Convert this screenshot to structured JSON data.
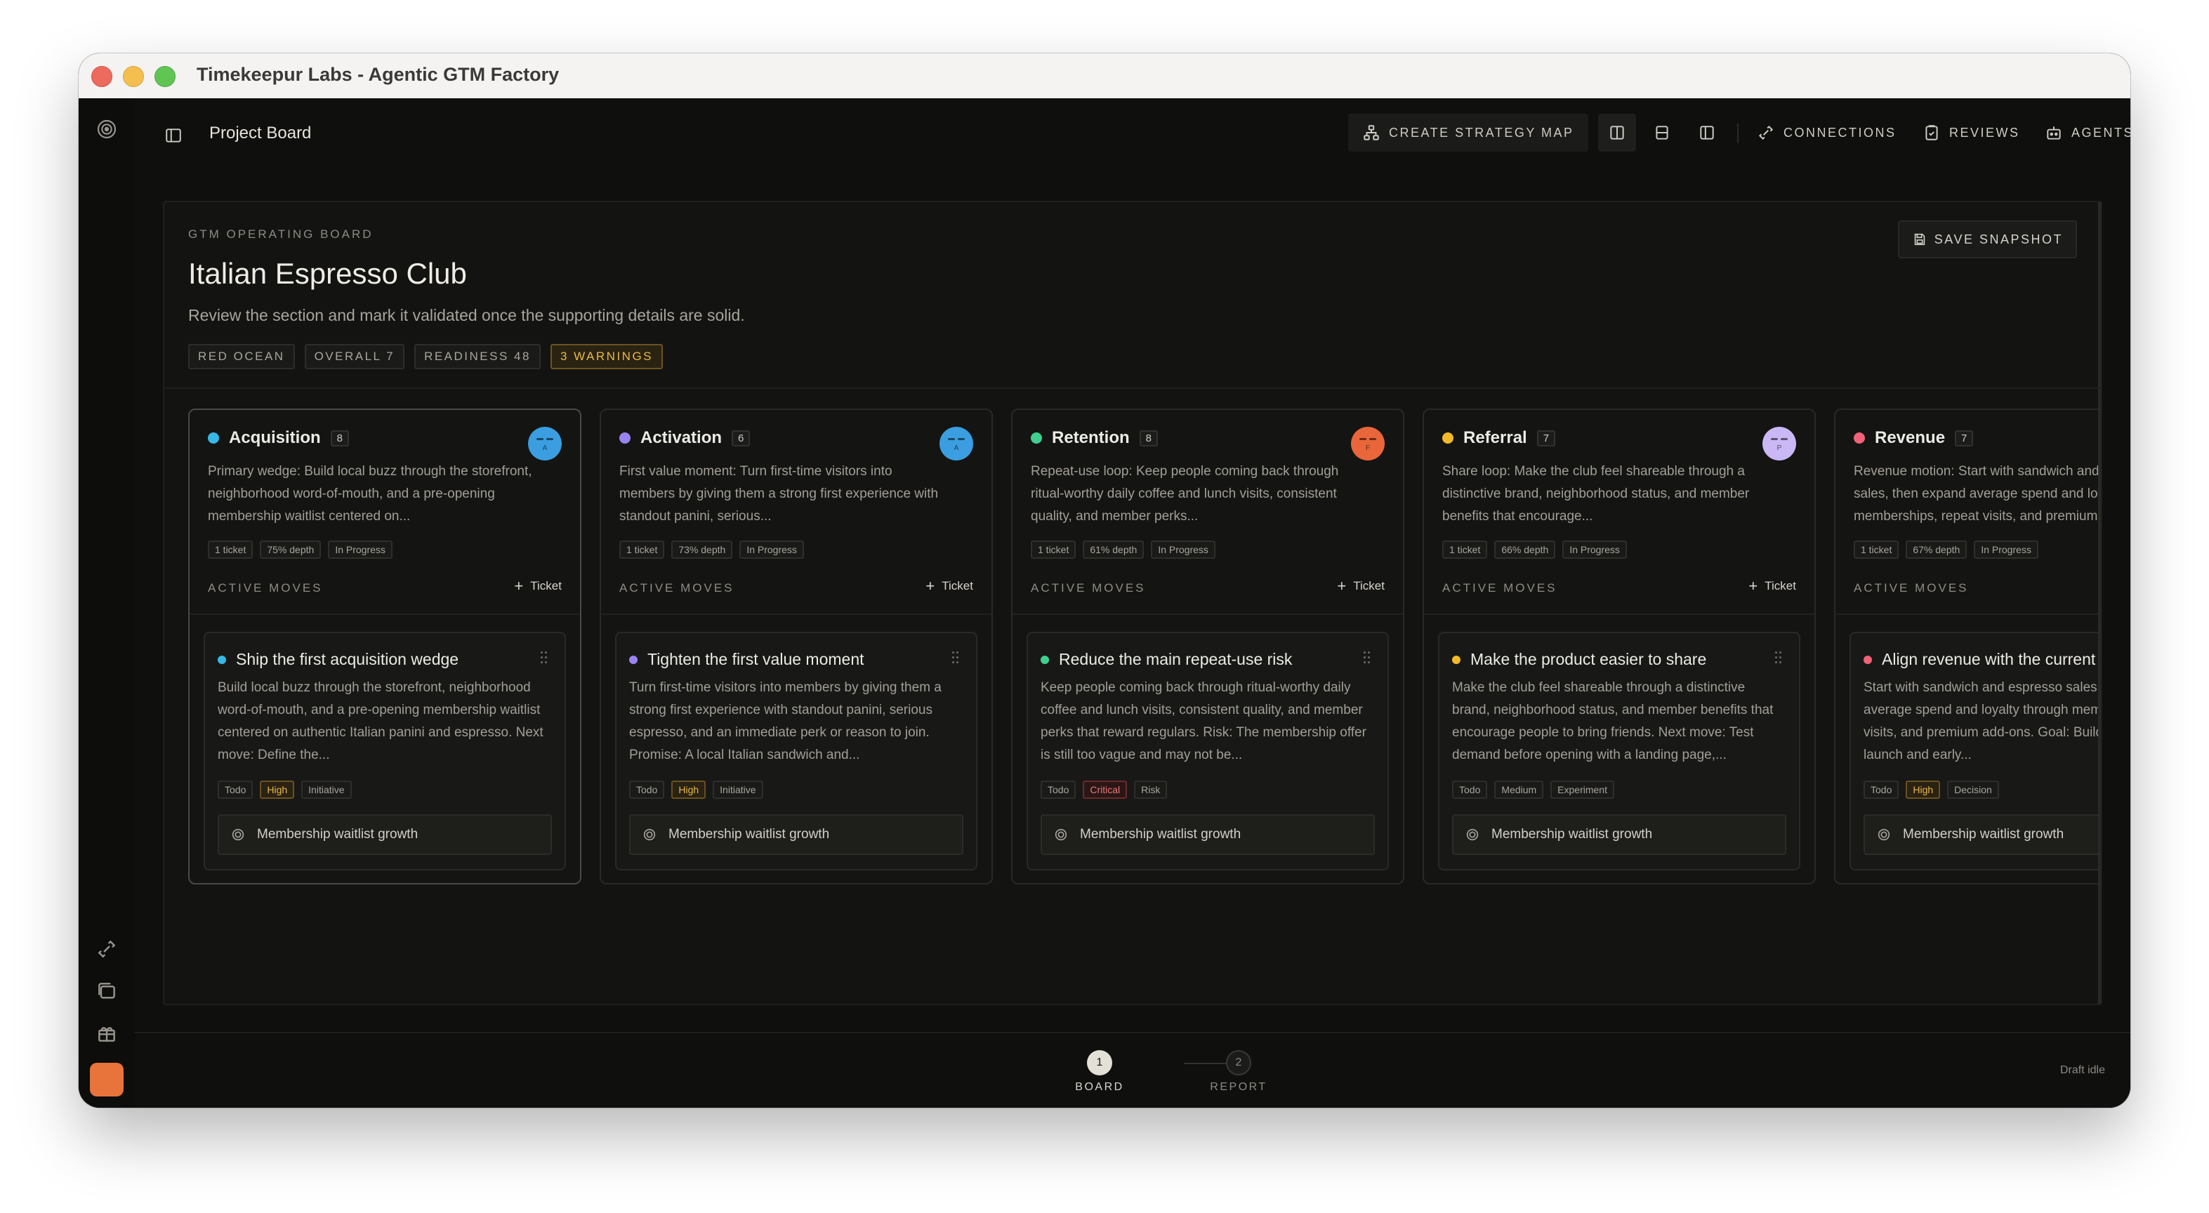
{
  "window": {
    "title": "Timekeepur Labs - Agentic GTM Factory"
  },
  "topbar": {
    "page_title": "Project Board",
    "create_strategy_map": "CREATE STRATEGY MAP",
    "connections": "CONNECTIONS",
    "reviews": "REVIEWS",
    "agents": "AGENTS"
  },
  "board": {
    "eyebrow": "GTM OPERATING BOARD",
    "title": "Italian Espresso Club",
    "description": "Review the section and mark it validated once the supporting details are solid.",
    "chips": [
      "RED OCEAN",
      "OVERALL 7",
      "READINESS 48",
      "3 WARNINGS"
    ],
    "save_snapshot": "SAVE SNAPSHOT",
    "active_moves_label": "ACTIVE MOVES",
    "ticket_label": "Ticket",
    "columns": [
      {
        "name": "Acquisition",
        "count": "8",
        "color": "#37b7e6",
        "avatar_color": "#3a9ee0",
        "avatar_letter": "A",
        "description": "Primary wedge: Build local buzz through the storefront, neighborhood word-of-mouth, and a pre-opening membership waitlist centered on...",
        "meta": [
          "1 ticket",
          "75% depth",
          "In Progress"
        ],
        "card": {
          "title": "Ship the first acquisition wedge",
          "description": "Build local buzz through the storefront, neighborhood word-of-mouth, and a pre-opening membership waitlist centered on authentic Italian panini and espresso. Next move: Define the...",
          "tags": [
            "Todo",
            "High",
            "Initiative"
          ],
          "metric": "Membership waitlist growth"
        }
      },
      {
        "name": "Activation",
        "count": "6",
        "color": "#9a83f0",
        "avatar_color": "#3a9ee0",
        "avatar_letter": "A",
        "description": "First value moment: Turn first-time visitors into members by giving them a strong first experience with standout panini, serious...",
        "meta": [
          "1 ticket",
          "73% depth",
          "In Progress"
        ],
        "card": {
          "title": "Tighten the first value moment",
          "description": "Turn first-time visitors into members by giving them a strong first experience with standout panini, serious espresso, and an immediate perk or reason to join. Promise: A local Italian sandwich and...",
          "tags": [
            "Todo",
            "High",
            "Initiative"
          ],
          "metric": "Membership waitlist growth"
        }
      },
      {
        "name": "Retention",
        "count": "8",
        "color": "#3ecf8e",
        "avatar_color": "#e8663a",
        "avatar_letter": "F",
        "description": "Repeat-use loop: Keep people coming back through ritual-worthy daily coffee and lunch visits, consistent quality, and member perks...",
        "meta": [
          "1 ticket",
          "61% depth",
          "In Progress"
        ],
        "card": {
          "title": "Reduce the main repeat-use risk",
          "description": "Keep people coming back through ritual-worthy daily coffee and lunch visits, consistent quality, and member perks that reward regulars. Risk: The membership offer is still too vague and may not be...",
          "tags": [
            "Todo",
            "Critical",
            "Risk"
          ],
          "metric": "Membership waitlist growth"
        }
      },
      {
        "name": "Referral",
        "count": "7",
        "color": "#f2b92b",
        "avatar_color": "#c9b8f5",
        "avatar_letter": "P",
        "description": "Share loop: Make the club feel shareable through a distinctive brand, neighborhood status, and member benefits that encourage...",
        "meta": [
          "1 ticket",
          "66% depth",
          "In Progress"
        ],
        "card": {
          "title": "Make the product easier to share",
          "description": "Make the club feel shareable through a distinctive brand, neighborhood status, and member benefits that encourage people to bring friends. Next move: Test demand before opening with a landing page,...",
          "tags": [
            "Todo",
            "Medium",
            "Experiment"
          ],
          "metric": "Membership waitlist growth"
        }
      },
      {
        "name": "Revenue",
        "count": "7",
        "color": "#f06277",
        "avatar_color": "",
        "avatar_letter": "",
        "description": "Revenue motion: Start with sandwich and espresso sales, then expand average spend and loyalty through memberships, repeat visits, and premium...",
        "meta": [
          "1 ticket",
          "67% depth",
          "In Progress"
        ],
        "card": {
          "title": "Align revenue with the current offer",
          "description": "Start with sandwich and espresso sales, then expand average spend and loyalty through memberships, repeat visits, and premium add-ons. Goal: Build a strong pre-launch and early...",
          "tags": [
            "Todo",
            "High",
            "Decision"
          ],
          "metric": "Membership waitlist growth"
        }
      }
    ]
  },
  "footer": {
    "steps": [
      {
        "number": "1",
        "label": "BOARD"
      },
      {
        "number": "2",
        "label": "REPORT"
      }
    ],
    "status": "Draft idle"
  }
}
